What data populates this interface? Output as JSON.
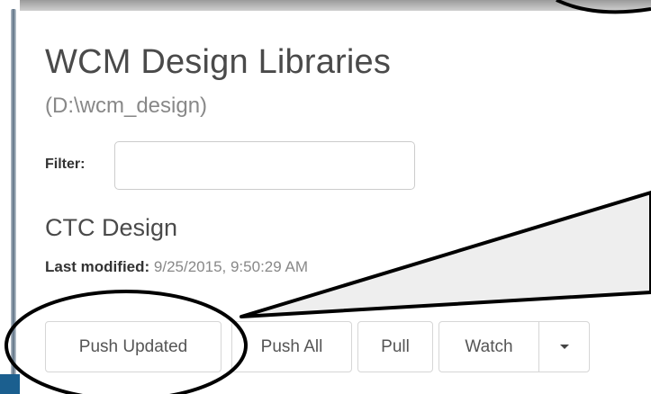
{
  "panel": {
    "title": "WCM Design Libraries",
    "path": "(D:\\wcm_design)",
    "filter_label": "Filter:",
    "filter_value": "",
    "filter_placeholder": ""
  },
  "library": {
    "name": "CTC Design",
    "modified_label": "Last modified:",
    "modified_value": "9/25/2015, 9:50:29 AM"
  },
  "actions": {
    "push_updated": "Push Updated",
    "push_all": "Push All",
    "pull": "Pull",
    "watch": "Watch"
  },
  "colors": {
    "callout_fill": "#eeeeee",
    "callout_stroke": "#000000",
    "bottom_band": "#1b5f8f"
  },
  "icons": {
    "dropdown": "caret-down-icon"
  }
}
